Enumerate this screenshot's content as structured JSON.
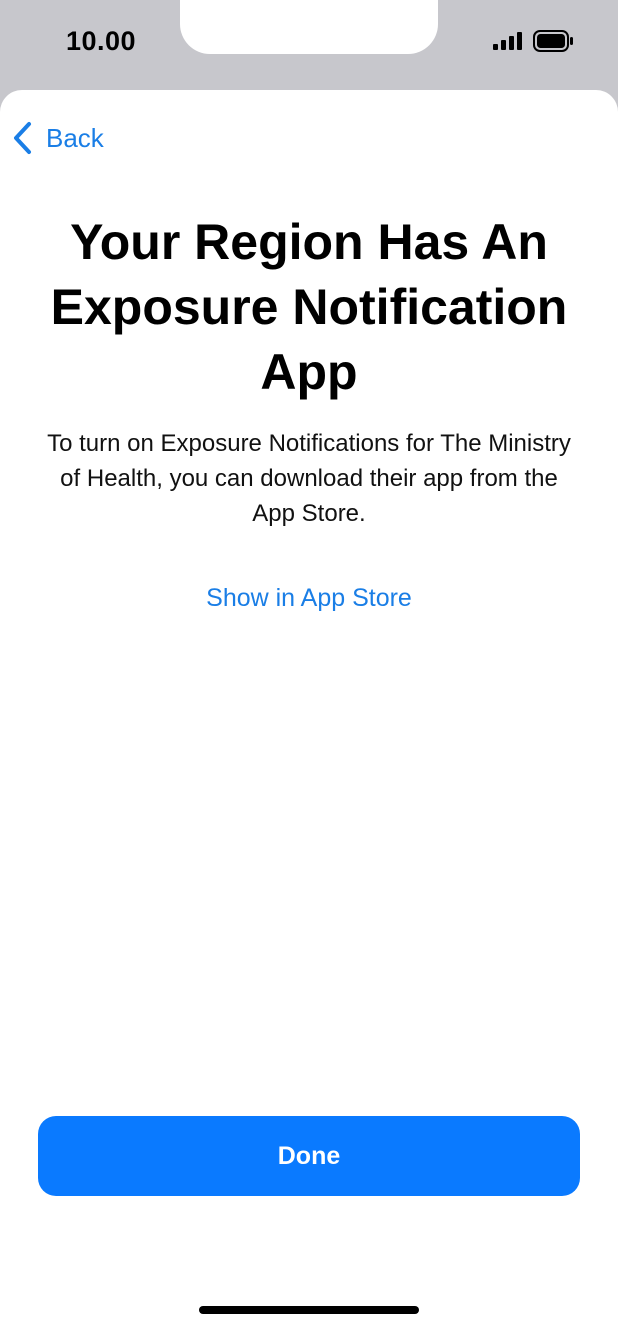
{
  "status_bar": {
    "time": "10.00",
    "signal_icon": "signal-bars-icon",
    "battery_icon": "battery-icon"
  },
  "nav": {
    "back_label": "Back",
    "back_icon": "chevron-left-icon"
  },
  "content": {
    "title": "Your Region Has An Exposure Notification App",
    "description": "To turn on Exposure Notifications for The Ministry of Health, you can download their app from the App Store.",
    "link_label": "Show in App Store"
  },
  "actions": {
    "done_label": "Done"
  },
  "colors": {
    "accent": "#0a7aff",
    "link": "#1a7ee6",
    "chrome": "#c7c7cc"
  }
}
